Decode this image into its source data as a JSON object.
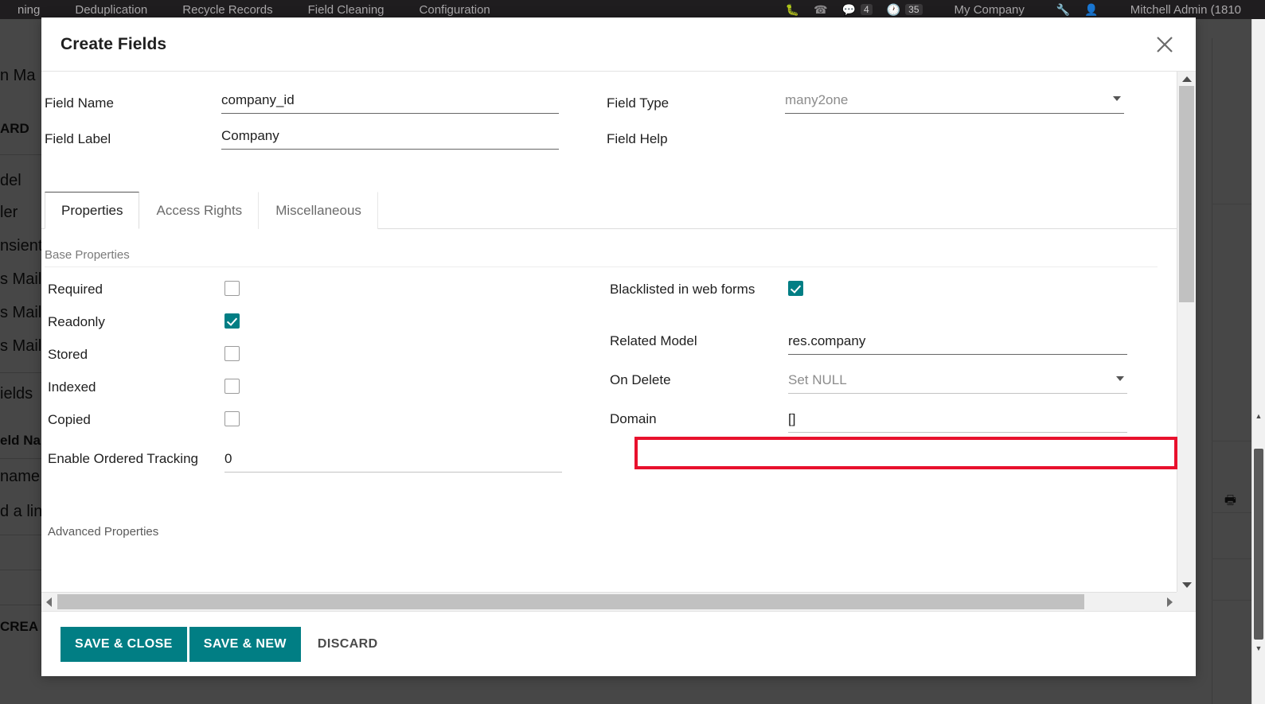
{
  "background": {
    "navbar": {
      "items": [
        "ning",
        "Deduplication",
        "Recycle Records",
        "Field Cleaning",
        "Configuration"
      ],
      "right": {
        "bug_icon": "bug-icon",
        "phone_icon": "phone-icon",
        "chat_icon": "chat-icon",
        "chat_badge": "4",
        "clock_icon": "clock-icon",
        "clock_badge": "35",
        "company": "My Company",
        "wrench_icon": "wrench-icon",
        "user_icon": "user-avatar-icon",
        "user": "Mitchell Admin (1810"
      }
    },
    "left_fragments": [
      "n Ma",
      "ARD",
      "del",
      "ler",
      "nsient",
      "s Mail T",
      "s Mail A",
      "s Mail I",
      "ields",
      "eld Nam",
      "name",
      "d a line",
      "CREA"
    ]
  },
  "modal": {
    "title": "Create Fields",
    "close_icon": "close-icon",
    "top_fields": {
      "left": [
        {
          "label": "Field Name",
          "value": "company_id",
          "type": "text",
          "placeholder": ""
        },
        {
          "label": "Field Label",
          "value": "Company",
          "type": "text",
          "placeholder": ""
        }
      ],
      "right": [
        {
          "label": "Field Type",
          "value": "many2one",
          "type": "select",
          "muted": true
        },
        {
          "label": "Field Help",
          "value": "",
          "type": "text",
          "placeholder": ""
        }
      ]
    },
    "tabs": [
      {
        "label": "Properties",
        "active": true
      },
      {
        "label": "Access Rights",
        "active": false
      },
      {
        "label": "Miscellaneous",
        "active": false
      }
    ],
    "properties": {
      "section_title": "Base Properties",
      "left_rows": [
        {
          "label": "Required",
          "type": "checkbox",
          "checked": false
        },
        {
          "label": "Readonly",
          "type": "checkbox",
          "checked": true
        },
        {
          "label": "Stored",
          "type": "checkbox",
          "checked": false
        },
        {
          "label": "Indexed",
          "type": "checkbox",
          "checked": false
        },
        {
          "label": "Copied",
          "type": "checkbox",
          "checked": false
        },
        {
          "label": "Enable Ordered Tracking",
          "type": "text",
          "value": "0"
        }
      ],
      "right_rows": [
        {
          "label": "Blacklisted in web forms",
          "type": "checkbox",
          "checked": true
        },
        {
          "label": "Related Model",
          "type": "text",
          "value": "res.company",
          "highlighted": true
        },
        {
          "label": "On Delete",
          "type": "select",
          "value": "Set NULL",
          "muted": true
        },
        {
          "label": "Domain",
          "type": "text",
          "value": "[]"
        }
      ],
      "advanced_title": "Advanced Properties"
    },
    "footer": {
      "save_close_label": "SAVE & CLOSE",
      "save_new_label": "SAVE & NEW",
      "discard_label": "DISCARD"
    }
  },
  "colors": {
    "accent_teal": "#017e84",
    "highlight_red": "#e8112d",
    "navbar_dark": "#1f1d1f"
  }
}
